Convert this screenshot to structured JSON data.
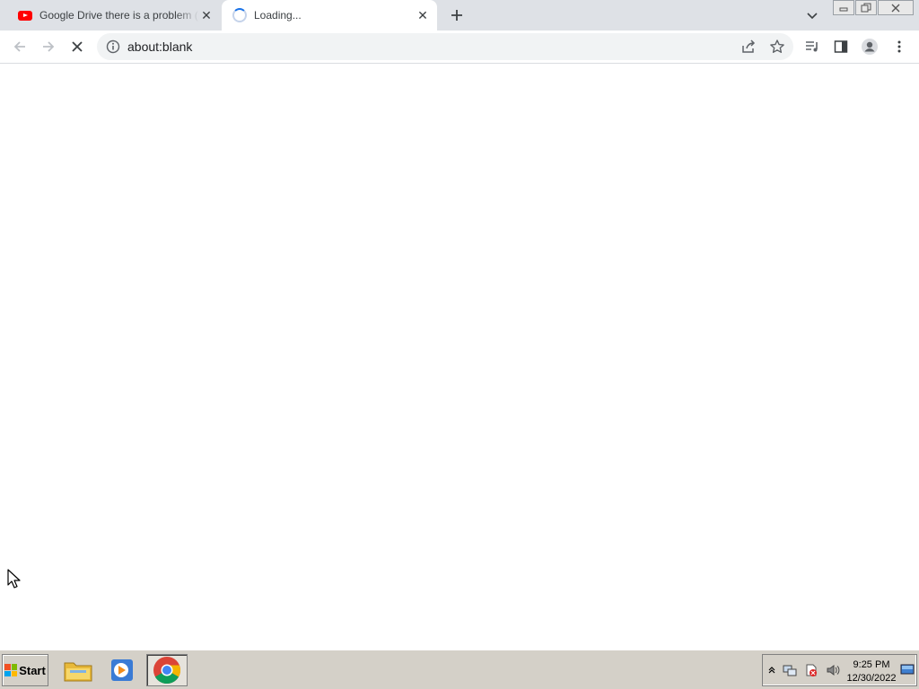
{
  "tabs": [
    {
      "title": "Google Drive there is a problem (No",
      "icon": "youtube-icon"
    },
    {
      "title": "Loading...",
      "icon": "loading-spinner-icon"
    }
  ],
  "omnibox": {
    "url": "about:blank"
  },
  "taskbar": {
    "start_label": "Start",
    "apps": [
      "file-explorer",
      "media-player",
      "chrome"
    ],
    "clock_time": "9:25 PM",
    "clock_date": "12/30/2022"
  },
  "colors": {
    "tabstrip": "#dee1e6",
    "accent": "#1a73e8",
    "taskbar": "#d4d0c8"
  }
}
